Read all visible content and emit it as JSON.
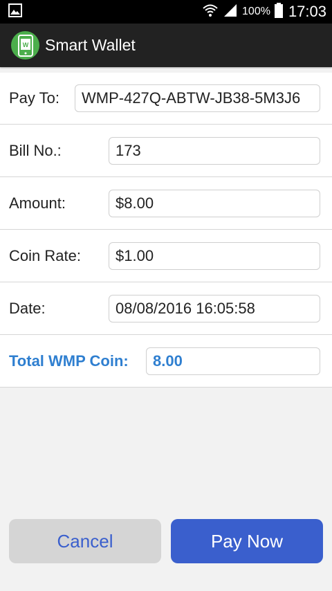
{
  "status_bar": {
    "battery": "100%",
    "time": "17:03"
  },
  "app": {
    "title": "Smart Wallet"
  },
  "form": {
    "pay_to": {
      "label": "Pay To:",
      "value": "WMP-427Q-ABTW-JB38-5M3J6"
    },
    "bill_no": {
      "label": "Bill No.:",
      "value": "173"
    },
    "amount": {
      "label": "Amount:",
      "value": "$8.00"
    },
    "coin_rate": {
      "label": "Coin Rate:",
      "value": "$1.00"
    },
    "date": {
      "label": "Date:",
      "value": "08/08/2016 16:05:58"
    },
    "total": {
      "label": "Total WMP Coin:",
      "value": "8.00"
    }
  },
  "buttons": {
    "cancel": "Cancel",
    "pay_now": "Pay Now"
  },
  "colors": {
    "accent_blue": "#3a5fcd",
    "label_blue": "#2f7fd0",
    "app_icon_green": "#4cae4c"
  }
}
